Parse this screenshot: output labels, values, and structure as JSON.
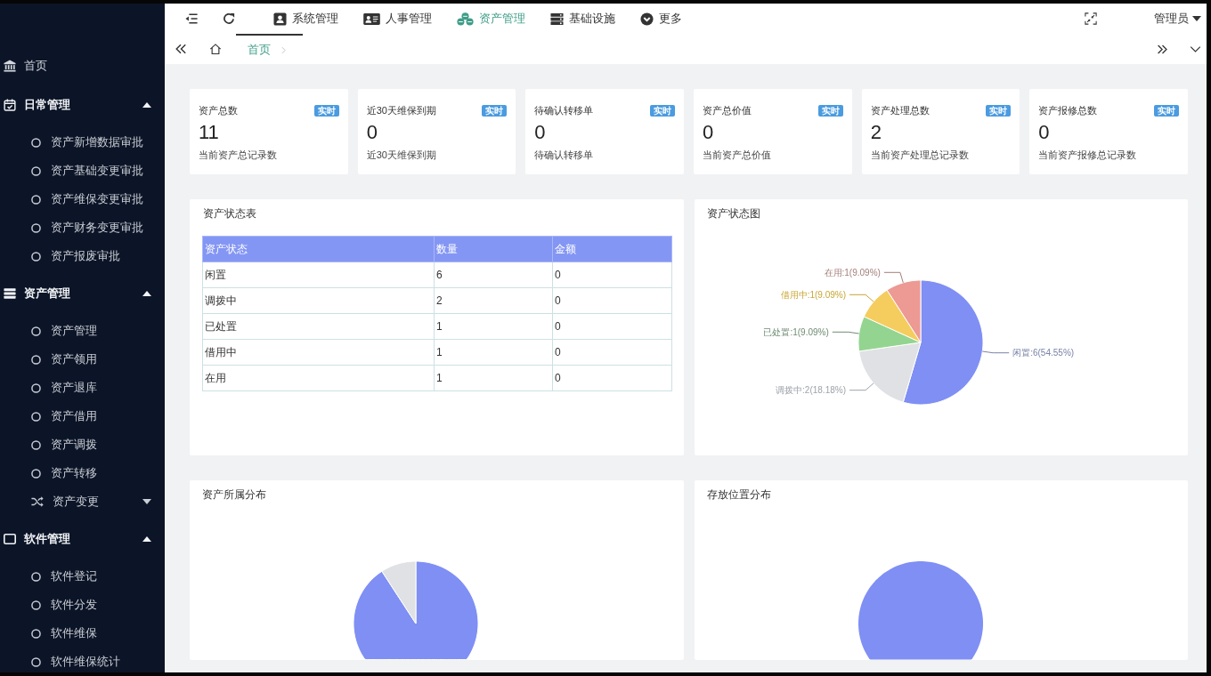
{
  "sidebar": {
    "items": [
      {
        "kind": "link",
        "label": "首页"
      },
      {
        "kind": "group",
        "label": "日常管理",
        "expanded": true,
        "children": [
          {
            "kind": "link",
            "label": "资产新增数据审批"
          },
          {
            "kind": "link",
            "label": "资产基础变更审批"
          },
          {
            "kind": "link",
            "label": "资产维保变更审批"
          },
          {
            "kind": "link",
            "label": "资产财务变更审批"
          },
          {
            "kind": "link",
            "label": "资产报废审批"
          }
        ]
      },
      {
        "kind": "group",
        "label": "资产管理",
        "expanded": true,
        "children": [
          {
            "kind": "link",
            "label": "资产管理"
          },
          {
            "kind": "link",
            "label": "资产领用"
          },
          {
            "kind": "link",
            "label": "资产退库"
          },
          {
            "kind": "link",
            "label": "资产借用"
          },
          {
            "kind": "link",
            "label": "资产调拨"
          },
          {
            "kind": "link",
            "label": "资产转移"
          },
          {
            "kind": "group",
            "label": "资产变更",
            "expanded": false
          }
        ]
      },
      {
        "kind": "group",
        "label": "软件管理",
        "expanded": true,
        "children": [
          {
            "kind": "link",
            "label": "软件登记"
          },
          {
            "kind": "link",
            "label": "软件分发"
          },
          {
            "kind": "link",
            "label": "软件维保"
          },
          {
            "kind": "link",
            "label": "软件维保统计"
          }
        ]
      }
    ]
  },
  "topbar": {
    "nav": [
      {
        "label": "系统管理",
        "selected": false
      },
      {
        "label": "人事管理",
        "selected": false
      },
      {
        "label": "资产管理",
        "selected": true
      },
      {
        "label": "基础设施",
        "selected": false
      },
      {
        "label": "更多",
        "selected": false
      }
    ],
    "user": "管理员"
  },
  "tabs": [
    {
      "label": "首页",
      "selected": true
    }
  ],
  "stats": [
    {
      "title": "资产总数",
      "badge": "实时",
      "value": "11",
      "caption": "当前资产总记录数"
    },
    {
      "title": "近30天维保到期",
      "badge": "实时",
      "value": "0",
      "caption": "近30天维保到期"
    },
    {
      "title": "待确认转移单",
      "badge": "实时",
      "value": "0",
      "caption": "待确认转移单"
    },
    {
      "title": "资产总价值",
      "badge": "实时",
      "value": "0",
      "caption": "当前资产总价值"
    },
    {
      "title": "资产处理总数",
      "badge": "实时",
      "value": "2",
      "caption": "当前资产处理总记录数"
    },
    {
      "title": "资产报修总数",
      "badge": "实时",
      "value": "0",
      "caption": "当前资产报修总记录数"
    }
  ],
  "status_table": {
    "title": "资产状态表",
    "columns": [
      "资产状态",
      "数量",
      "金额"
    ],
    "rows": [
      [
        "闲置",
        "6",
        "0"
      ],
      [
        "调拨中",
        "2",
        "0"
      ],
      [
        "已处置",
        "1",
        "0"
      ],
      [
        "借用中",
        "1",
        "0"
      ],
      [
        "在用",
        "1",
        "0"
      ]
    ]
  },
  "status_chart": {
    "chart_data": {
      "type": "pie",
      "title": "资产状态图",
      "values": [
        6,
        2,
        1,
        1,
        1
      ],
      "value_labels": [
        "闲置:6(54.55%)",
        "调拨中:2(18.18%)",
        "已处置:1(9.09%)",
        "借用中:1(9.09%)",
        "在用:1(9.09%)"
      ]
    }
  },
  "ownership_chart": {
    "title": "资产所属分布"
  },
  "location_chart": {
    "title": "存放位置分布"
  }
}
